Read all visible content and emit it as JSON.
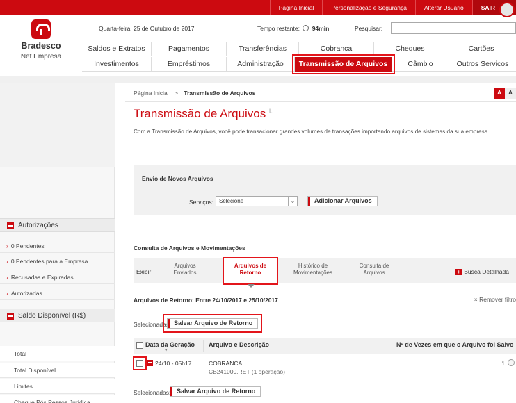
{
  "topbar": {
    "links": [
      "Página Inicial",
      "Personalização e Segurança",
      "Alterar Usuário",
      "SAIR"
    ]
  },
  "brand": {
    "name": "Bradesco",
    "sub": "Net Empresa",
    "color": "#cc0a10"
  },
  "info": {
    "date": "Quarta-feira, 25 de Outubro de 2017",
    "timer_label": "Tempo restante:",
    "timer_value": "94min",
    "search_label": "Pesquisar:",
    "search_value": ""
  },
  "nav": {
    "row1": [
      "Saldos e Extratos",
      "Pagamentos",
      "Transferências",
      "Cobranca",
      "Cheques",
      "Cartões"
    ],
    "row2": [
      "Investimentos",
      "Empréstimos",
      "Administração",
      "Transmissão de Arquivos",
      "Câmbio",
      "Outros Servicos"
    ]
  },
  "sidebar": {
    "autorizacoes_title": "Autorizações",
    "autorizacoes": [
      "0 Pendentes",
      "0 Pendentes para a Empresa",
      "Recusadas e Expiradas",
      "Autorizadas"
    ],
    "saldo_title": "Saldo Disponível (R$)",
    "saldo_items": [
      "Total",
      "Total Disponível",
      "Limites",
      "Cheque Pós Pessoa Jurídica"
    ]
  },
  "main": {
    "breadcrumb_home": "Página Inicial",
    "breadcrumb_sep": ">",
    "breadcrumb_current": "Transmissão de Arquivos",
    "font_small": "A",
    "font_large": "A",
    "title": "Transmissão de Arquivos",
    "title_mark": "L",
    "description": "Com a Transmissão de Arquivos, você pode transacionar grandes volumes de transações importando arquivos de sistemas da sua empresa.",
    "envio": {
      "title": "Envio de Novos Arquivos",
      "servicos_label": "Serviços:",
      "servicos_value": "Selecione",
      "add_button": "Adicionar Arquivos"
    },
    "consulta_title": "Consulta de Arquivos e Movimentações",
    "exibir_label": "Exibir:",
    "tabs": [
      {
        "label1": "Arquivos",
        "label2": "Enviados"
      },
      {
        "label1": "Arquivos de",
        "label2": "Retorno"
      },
      {
        "label1": "Histórico de",
        "label2": "Movimentações"
      },
      {
        "label1": "Consulta de",
        "label2": "Arquivos"
      }
    ],
    "busca": "Busca Detalhada",
    "periodo": "Arquivos de Retorno: Entre 24/10/2017 e 25/10/2017",
    "remover": "× Remover filtro",
    "selecionadas": "Selecionadas:",
    "save_button": "Salvar Arquivo de Retorno",
    "table": {
      "headers": [
        "Data da Geração",
        "Arquivo e Descrição",
        "Nº de Vezes em que o Arquivo foi Salvo"
      ],
      "rows": [
        {
          "date": "24/10 - 05h17",
          "arquivo": "COBRANCA",
          "descricao": "CB241000.RET (1 operação)",
          "vezes": "1"
        }
      ]
    }
  }
}
